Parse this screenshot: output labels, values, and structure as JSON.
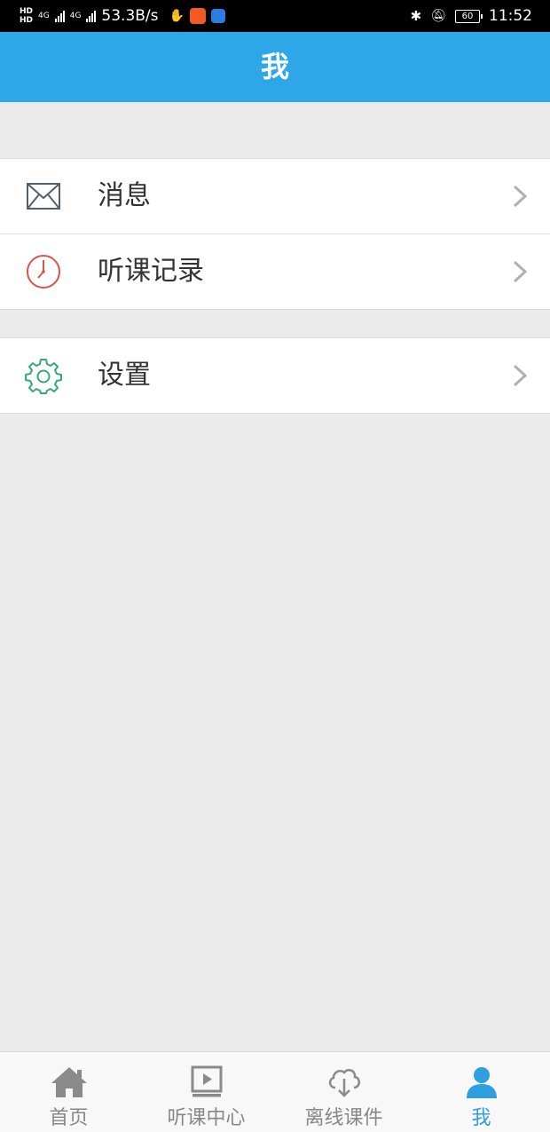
{
  "status_bar": {
    "hd_top": "HD",
    "hd_bottom": "HD",
    "net1": "4G",
    "net2": "4G",
    "speed": "53.3B/s",
    "battery": "60",
    "time": "11:52"
  },
  "header": {
    "title": "我"
  },
  "menu": {
    "group1": [
      {
        "label": "消息",
        "icon": "mail-icon",
        "icon_color": "#55606a"
      },
      {
        "label": "听课记录",
        "icon": "clock-icon",
        "icon_color": "#d9534f"
      }
    ],
    "group2": [
      {
        "label": "设置",
        "icon": "gear-icon",
        "icon_color": "#3aa876"
      }
    ]
  },
  "bottom_nav": {
    "items": [
      {
        "label": "首页",
        "icon": "home-icon"
      },
      {
        "label": "听课中心",
        "icon": "video-icon"
      },
      {
        "label": "离线课件",
        "icon": "cloud-download-icon"
      },
      {
        "label": "我",
        "icon": "user-icon",
        "active": true
      }
    ]
  },
  "colors": {
    "header_bg": "#2ea7e8",
    "active_tab": "#2e9fe0",
    "page_bg": "#ebebeb",
    "inactive_tab": "#888888"
  }
}
